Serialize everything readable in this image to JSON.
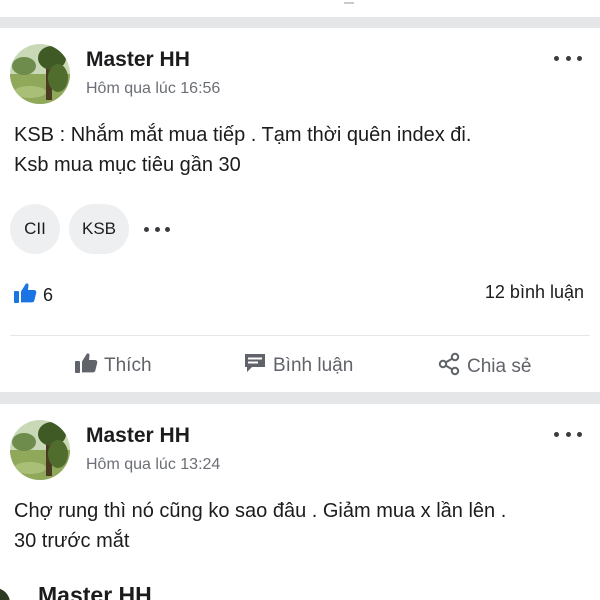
{
  "feed": {
    "posts": [
      {
        "author": "Master HH",
        "time": "Hôm qua lúc 16:56",
        "text_lines": [
          "KSB : Nhắm mắt mua tiếp . Tạm thời quên index đi.",
          "Ksb mua mục tiêu gần 30"
        ],
        "tags": [
          "CII",
          "KSB"
        ],
        "likes": "6",
        "comments": "12 bình luận",
        "actions": {
          "like": "Thích",
          "comment": "Bình luận",
          "share": "Chia sẻ"
        }
      },
      {
        "author": "Master HH",
        "time": "Hôm qua lúc 13:24",
        "text_lines": [
          "Chợ rung thì nó cũng ko sao đâu . Giảm mua x lần lên .",
          "30 trước mắt"
        ]
      },
      {
        "author": "Master HH"
      }
    ]
  },
  "colors": {
    "like_blue": "#1b74e4",
    "action_gray": "#606369",
    "separator": "#e4e6e8",
    "chip_bg": "#eeeff1"
  },
  "icons": [
    "more-dots-icon",
    "thumbs-up-icon",
    "comment-bubble-icon",
    "share-icon"
  ]
}
